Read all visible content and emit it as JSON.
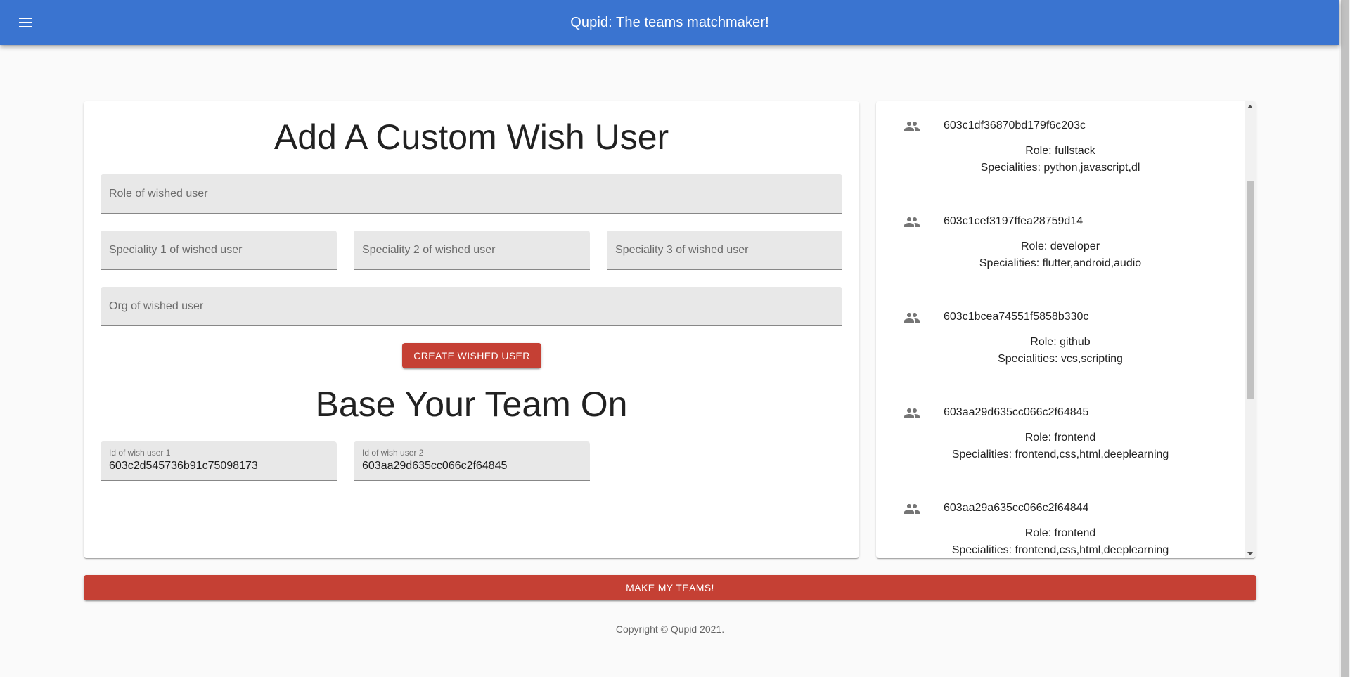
{
  "appbar": {
    "title": "Qupid: The teams matchmaker!",
    "menu_icon": "menu-icon"
  },
  "wish_form": {
    "heading": "Add A Custom Wish User",
    "role_placeholder": "Role of wished user",
    "speciality1_placeholder": "Speciality 1 of wished user",
    "speciality2_placeholder": "Speciality 2 of wished user",
    "speciality3_placeholder": "Speciality 3 of wished user",
    "org_placeholder": "Org of wished user",
    "create_button": "CREATE WISHED USER"
  },
  "base_team": {
    "heading": "Base Your Team On",
    "wish1_label": "Id of wish user 1",
    "wish1_value": "603c2d545736b91c75098173",
    "wish2_label": "Id of wish user 2",
    "wish2_value": "603aa29d635cc066c2f64845"
  },
  "users": [
    {
      "id": "603c1df36870bd179f6c203c",
      "role": "Role: fullstack",
      "specialities": "Specialities: python,javascript,dl",
      "icon": "people-icon"
    },
    {
      "id": "603c1cef3197ffea28759d14",
      "role": "Role: developer",
      "specialities": "Specialities: flutter,android,audio",
      "icon": "people-icon"
    },
    {
      "id": "603c1bcea74551f5858b330c",
      "role": "Role: github",
      "specialities": "Specialities: vcs,scripting",
      "icon": "people-icon"
    },
    {
      "id": "603aa29d635cc066c2f64845",
      "role": "Role: frontend",
      "specialities": "Specialities: frontend,css,html,deeplearning",
      "icon": "people-icon"
    },
    {
      "id": "603aa29a635cc066c2f64844",
      "role": "Role: frontend",
      "specialities": "Specialities: frontend,css,html,deeplearning",
      "icon": "people-icon"
    }
  ],
  "make_teams_button": "MAKE MY TEAMS!",
  "footer": "Copyright © Qupid 2021.",
  "colors": {
    "appbar": "#3a74d0",
    "button": "#c54034",
    "field_bg": "#e8e8e8"
  }
}
